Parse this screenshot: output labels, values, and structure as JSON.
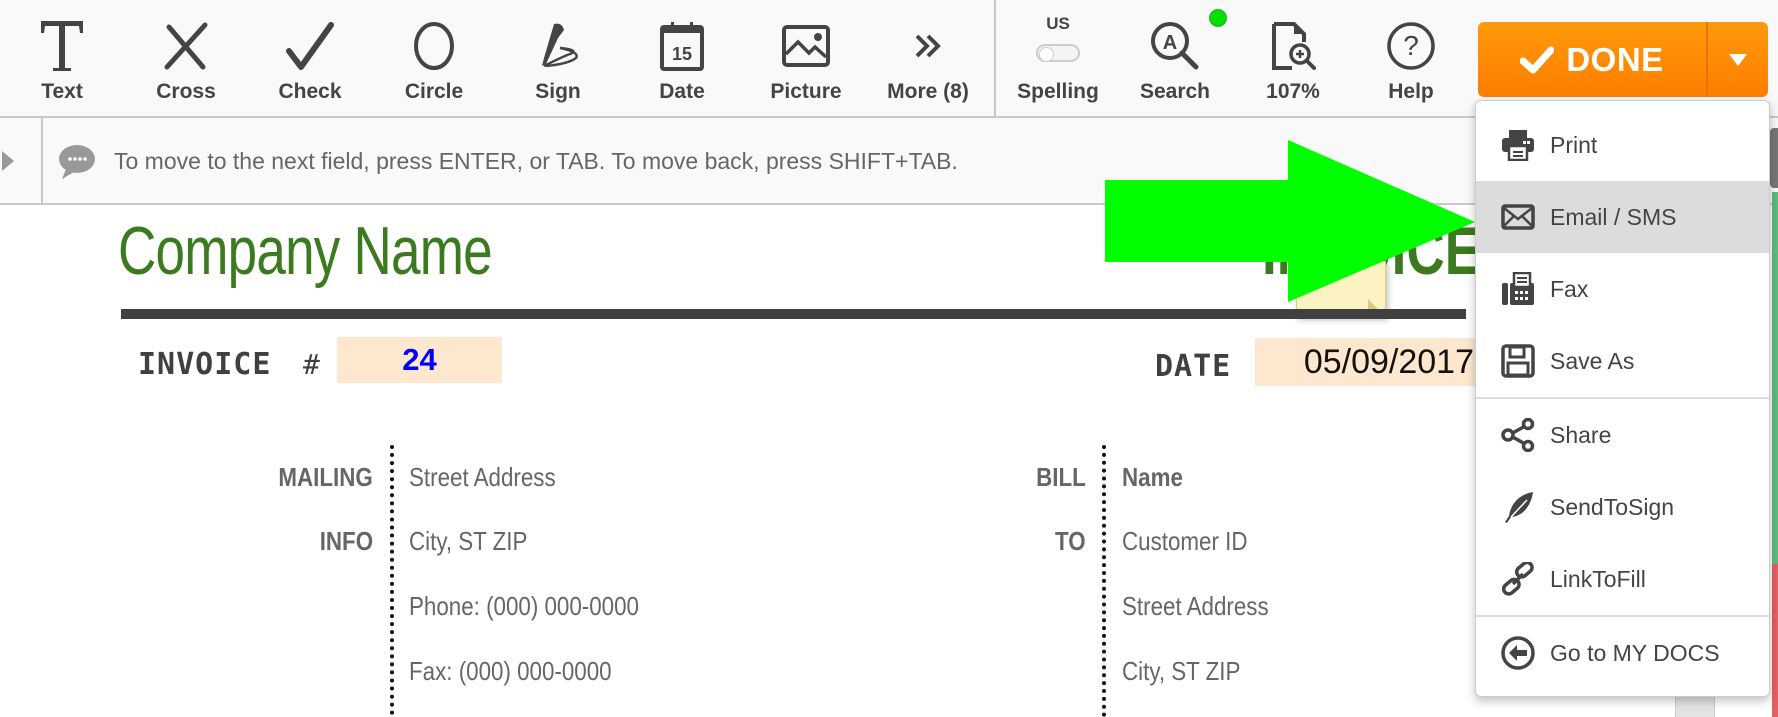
{
  "toolbar": {
    "tools": [
      {
        "id": "text",
        "label": "Text",
        "icon": "text-icon"
      },
      {
        "id": "cross",
        "label": "Cross",
        "icon": "cross-icon"
      },
      {
        "id": "check",
        "label": "Check",
        "icon": "check-icon"
      },
      {
        "id": "circle",
        "label": "Circle",
        "icon": "circle-icon"
      },
      {
        "id": "sign",
        "label": "Sign",
        "icon": "pen-sign-icon"
      },
      {
        "id": "date",
        "label": "Date",
        "icon": "calendar-icon",
        "calendar_day": "15"
      },
      {
        "id": "picture",
        "label": "Picture",
        "icon": "image-icon"
      },
      {
        "id": "more",
        "label": "More (8)",
        "icon": "double-chevron-right-icon"
      }
    ],
    "spelling": {
      "label": "Spelling",
      "locale": "US",
      "enabled": false
    },
    "search": {
      "label": "Search",
      "status_dot_color": "#00e000"
    },
    "zoom": {
      "label": "107%"
    },
    "help": {
      "label": "Help"
    },
    "done": {
      "label": "DONE",
      "color": "#ff8a00"
    }
  },
  "hint": {
    "text": "To move to the next field, press ENTER, or TAB. To move back, press SHIFT+TAB."
  },
  "document": {
    "company_name": "Company Name",
    "title_partial": "INVOICE",
    "invoice_label": "INVOICE",
    "invoice_hash": "#",
    "invoice_number": "24",
    "date_label": "DATE",
    "date_value": "05/09/2017",
    "mailing": {
      "label_line1": "MAILING",
      "label_line2": "INFO",
      "lines": [
        "Street Address",
        "City, ST ZIP",
        "Phone: (000) 000-0000",
        "Fax: (000) 000-0000"
      ]
    },
    "bill_to": {
      "label_line1": "BILL",
      "label_line2": "TO",
      "lines": [
        "Name",
        "Customer ID",
        "Street Address",
        "City, ST ZIP"
      ]
    },
    "brand_color": "#3b7a1e",
    "field_bg": "#fde8cf"
  },
  "done_menu": {
    "items": [
      {
        "label": "Print",
        "icon": "printer-icon",
        "active": false
      },
      {
        "label": "Email / SMS",
        "icon": "envelope-icon",
        "active": true
      },
      {
        "label": "Fax",
        "icon": "fax-icon",
        "active": false
      },
      {
        "label": "Save As",
        "icon": "floppy-disk-icon",
        "active": false
      },
      {
        "label": "Share",
        "icon": "share-icon",
        "active": false
      },
      {
        "label": "SendToSign",
        "icon": "feather-icon",
        "active": false
      },
      {
        "label": "LinkToFill",
        "icon": "link-icon",
        "active": false
      },
      {
        "label": "Go to MY DOCS",
        "icon": "circle-arrow-left-icon",
        "active": false
      }
    ]
  },
  "annotation": {
    "arrow_color": "#00ff00"
  }
}
